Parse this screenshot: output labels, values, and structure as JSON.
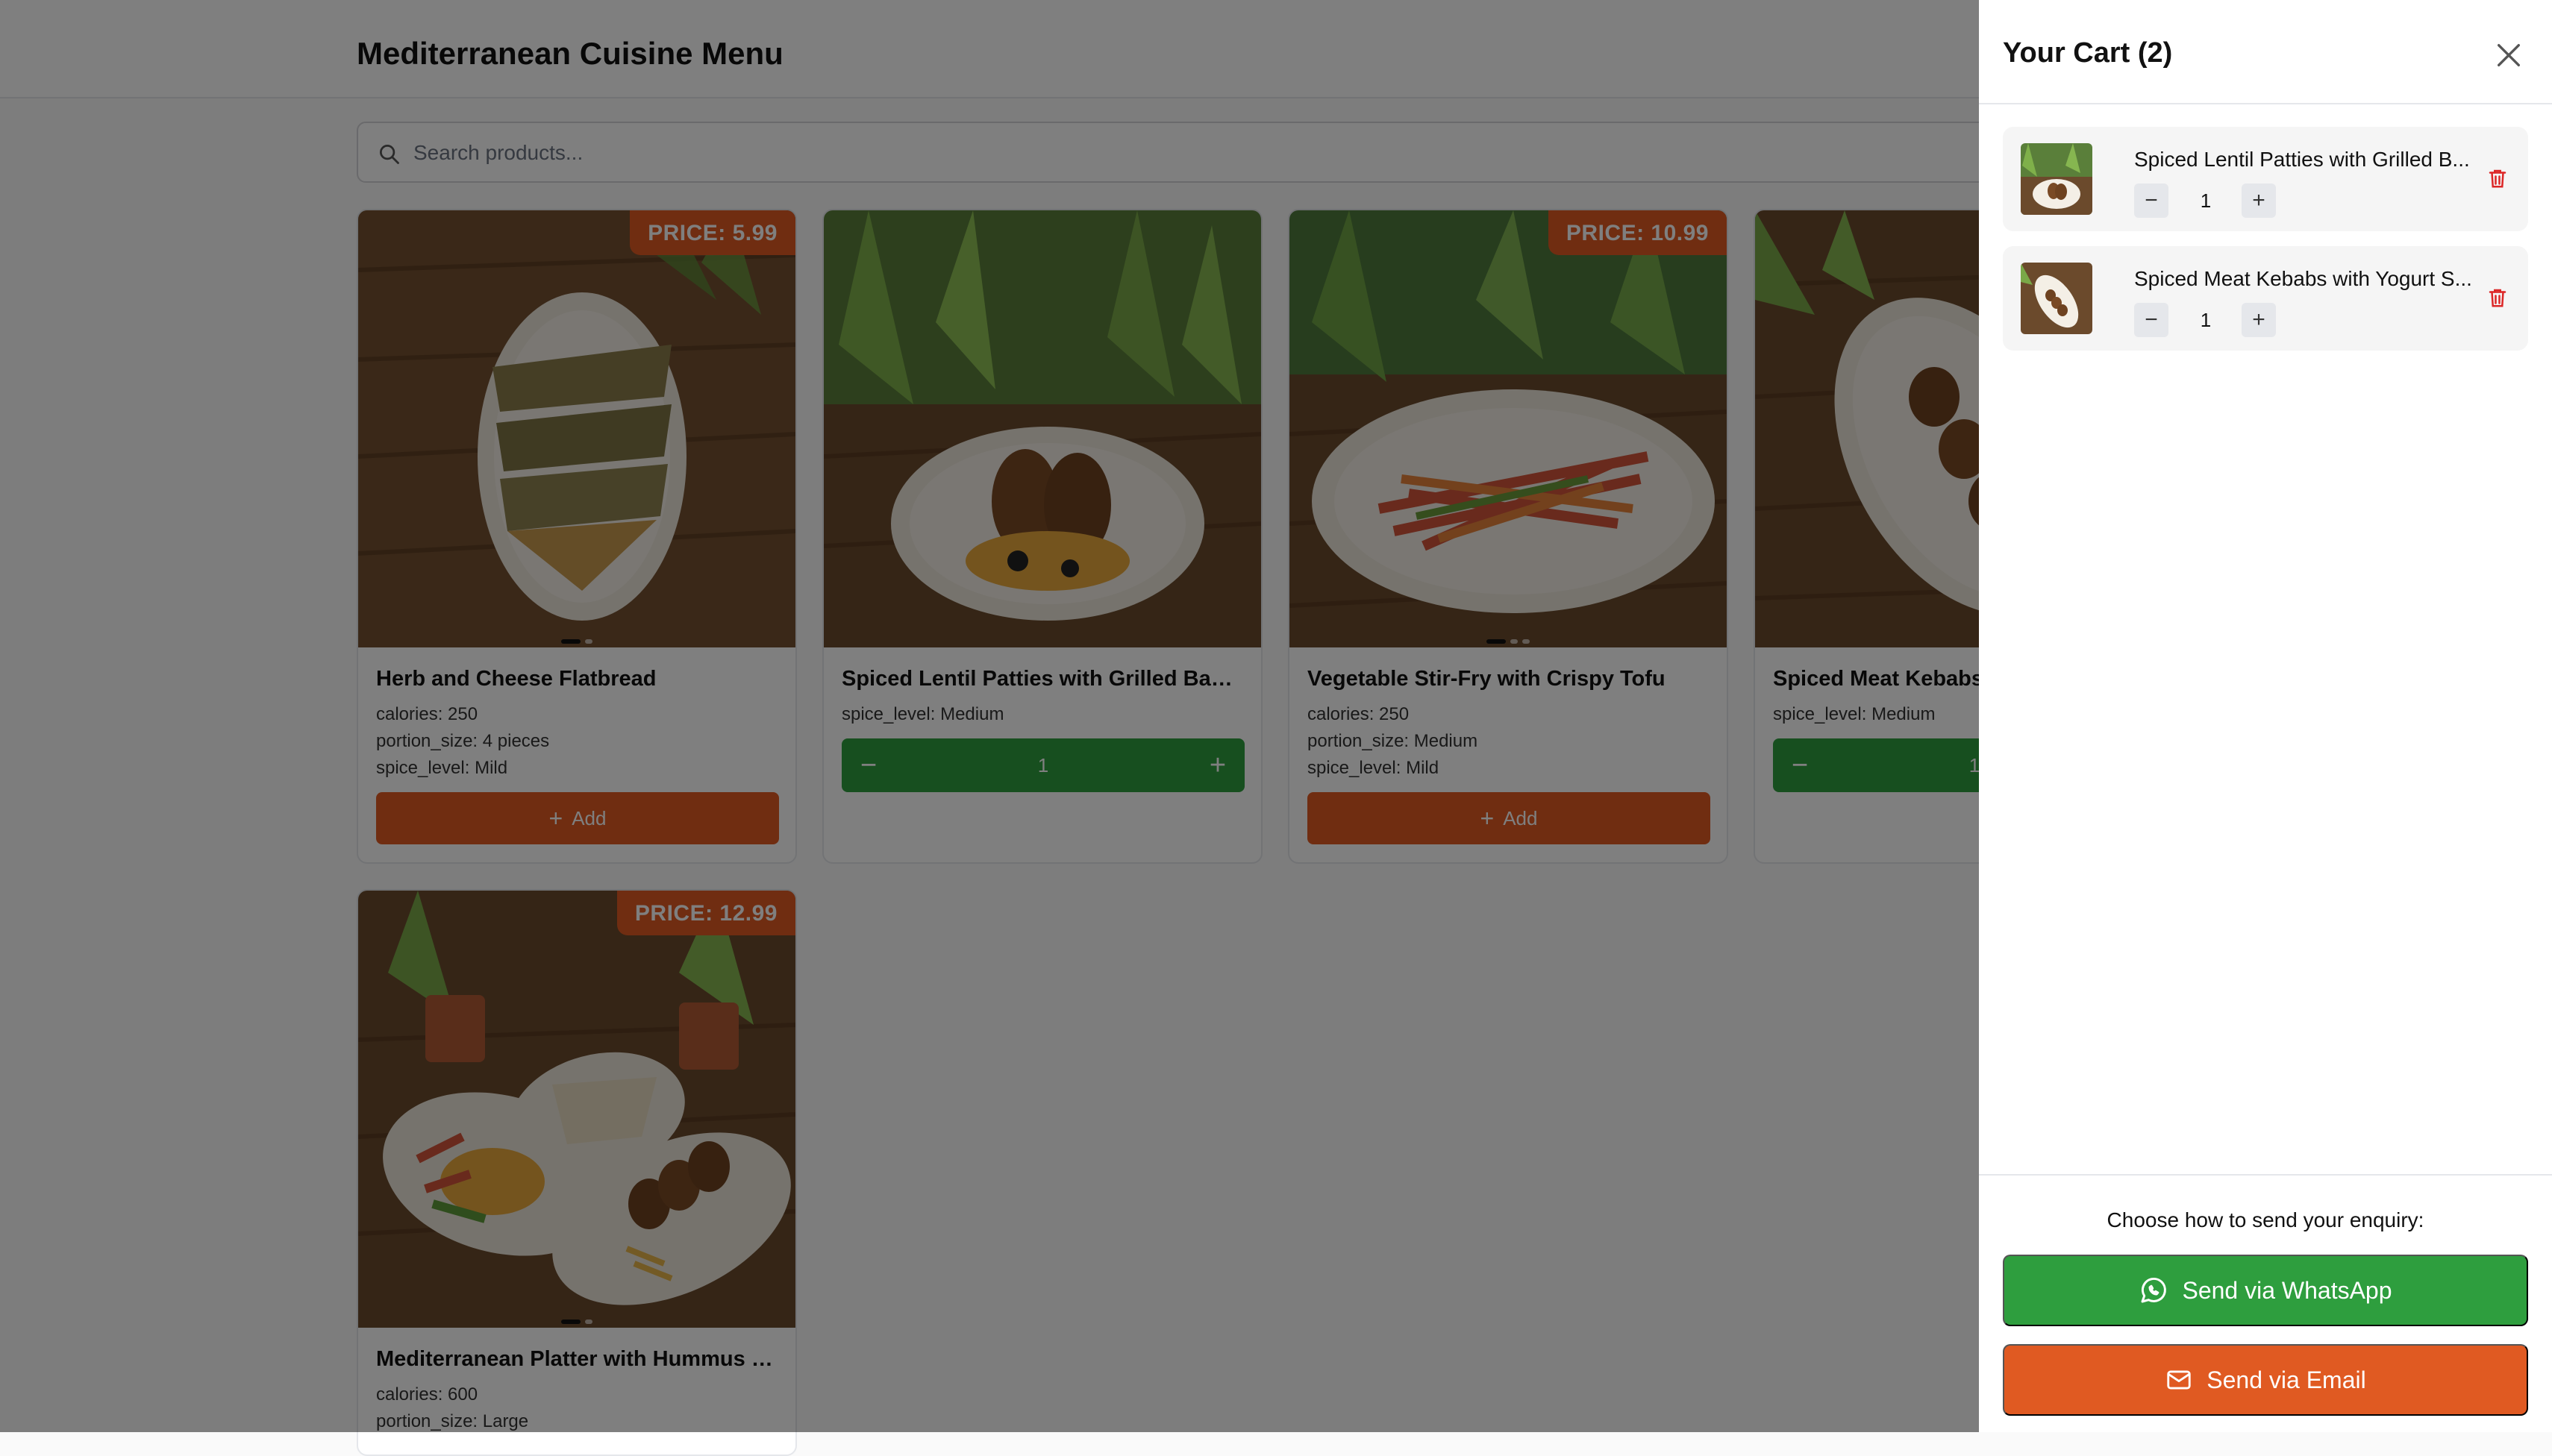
{
  "header": {
    "title": "Mediterranean Cuisine Menu"
  },
  "search": {
    "placeholder": "Search products..."
  },
  "products": [
    {
      "name": "Herb and Cheese Flatbread",
      "price_label": "PRICE: 5.99",
      "attrs": [
        "calories: 250",
        "portion_size: 4 pieces",
        "spice_level: Mild"
      ],
      "action": "Add"
    },
    {
      "name": "Spiced Lentil Patties with Grilled Bana...",
      "attrs": [
        "spice_level: Medium"
      ],
      "quantity": "1"
    },
    {
      "name": "Vegetable Stir-Fry with Crispy Tofu",
      "price_label": "PRICE: 10.99",
      "attrs": [
        "calories: 250",
        "portion_size: Medium",
        "spice_level: Mild"
      ],
      "action": "Add"
    },
    {
      "name": "Spiced Meat Kebabs",
      "attrs": [
        "spice_level: Medium"
      ],
      "quantity": "1"
    },
    {
      "name": "Mediterranean Platter with Hummus a...",
      "price_label": "PRICE: 12.99",
      "attrs": [
        "calories: 600",
        "portion_size: Large"
      ]
    }
  ],
  "cart": {
    "title": "Your Cart (2)",
    "items": [
      {
        "name": "Spiced Lentil Patties with Grilled B...",
        "quantity": "1"
      },
      {
        "name": "Spiced Meat Kebabs with Yogurt S...",
        "quantity": "1"
      }
    ],
    "prompt": "Choose how to send your enquiry:",
    "whatsapp_label": "Send via WhatsApp",
    "email_label": "Send via Email"
  },
  "colors": {
    "accent": "#e05a22",
    "success": "#2e9e3e"
  },
  "icons": [
    "search-icon",
    "close-icon",
    "trash-icon",
    "plus-icon",
    "minus-icon",
    "whatsapp-icon",
    "mail-icon"
  ]
}
